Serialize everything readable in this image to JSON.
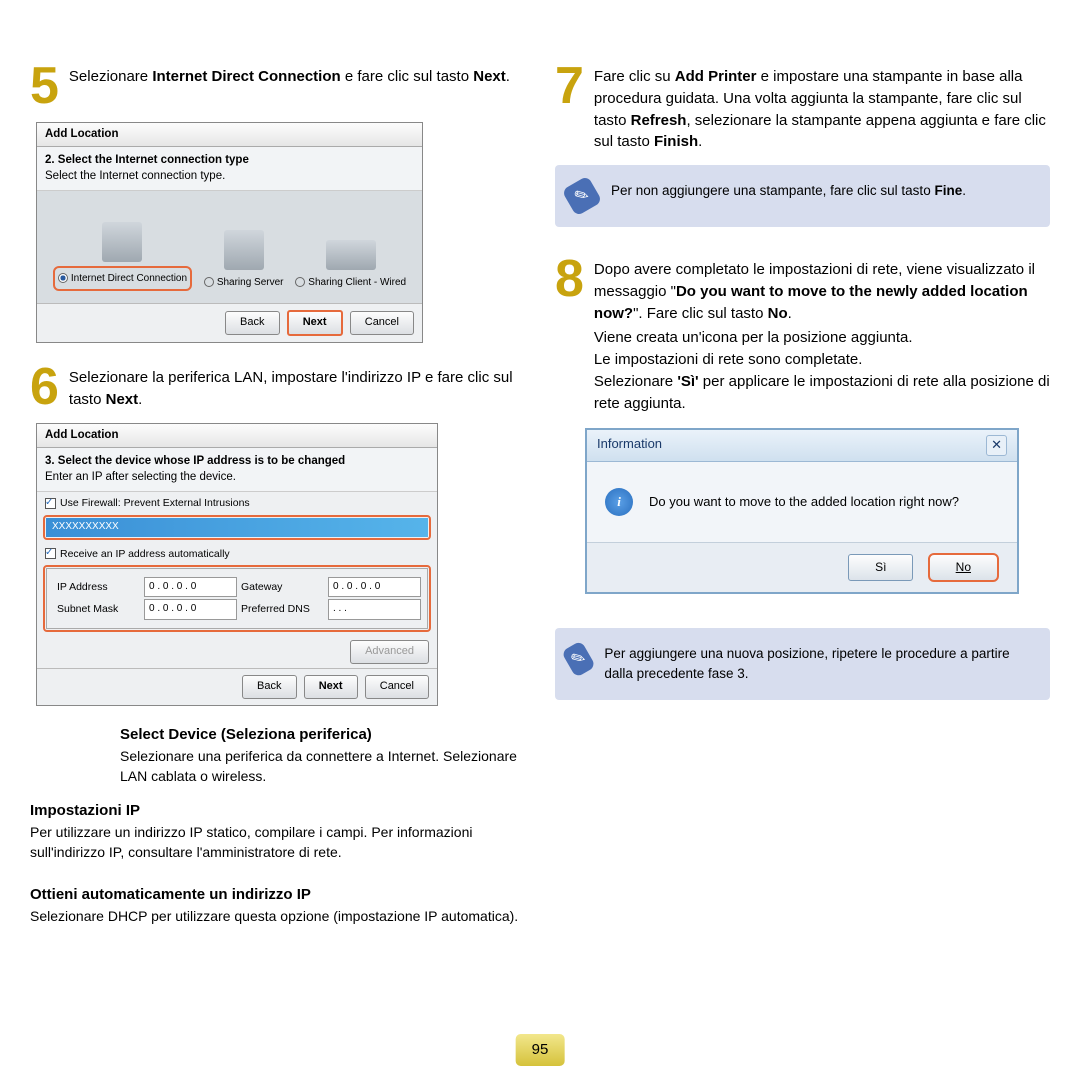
{
  "page_number": "95",
  "step5": {
    "num": "5",
    "text_pre": "Selezionare ",
    "bold1": "Internet Direct Connection",
    "text_mid": " e fare clic sul tasto ",
    "bold2": "Next",
    "text_post": "."
  },
  "dialog5": {
    "title": "Add Location",
    "subtitle_bold": "2. Select the Internet connection type",
    "subtitle_desc": "Select the Internet connection type.",
    "opt1": "Internet Direct Connection",
    "opt2": "Sharing Server",
    "opt3": "Sharing Client - Wired",
    "back": "Back",
    "next": "Next",
    "cancel": "Cancel"
  },
  "step6": {
    "num": "6",
    "line1": "Selezionare la periferica LAN, impostare l'indirizzo IP e fare clic sul tasto ",
    "bold": "Next",
    "post": "."
  },
  "dialog6": {
    "title": "Add Location",
    "subtitle_bold": "3. Select the device whose IP address is to be changed",
    "subtitle_desc": "Enter an IP after selecting the device.",
    "firewall": "Use Firewall: Prevent External Intrusions",
    "device_placeholder": "XXXXXXXXXX",
    "auto_ip": "Receive an IP address automatically",
    "ip_addr_label": "IP Address",
    "ip_val": "0 . 0 . 0 . 0",
    "subnet_label": "Subnet Mask",
    "gateway_label": "Gateway",
    "dns_label": "Preferred DNS",
    "dns_val": ". . .",
    "advanced": "Advanced",
    "back": "Back",
    "next": "Next",
    "cancel": "Cancel"
  },
  "callouts": {
    "select_device_title": "Select Device (Seleziona periferica)",
    "select_device_text": "Selezionare una periferica da connettere a Internet. Selezionare LAN cablata o wireless.",
    "ip_settings_title": "Impostazioni IP",
    "ip_settings_text": "Per utilizzare un indirizzo IP statico, compilare i campi. Per informazioni sull'indirizzo IP, consultare l'amministratore di rete.",
    "auto_ip_title": "Ottieni automaticamente un indirizzo IP",
    "auto_ip_text": "Selezionare DHCP per utilizzare questa opzione (impostazione IP automatica)."
  },
  "step7": {
    "num": "7",
    "pre": "Fare clic su ",
    "b1": "Add Printer",
    "mid1": " e impostare una stampante in base alla procedura guidata. Una volta aggiunta la stampante, fare clic sul tasto ",
    "b2": "Refresh",
    "mid2": ", selezionare la stampante appena aggiunta e fare clic sul tasto ",
    "b3": "Finish",
    "post": "."
  },
  "note7": {
    "text": "Per non aggiungere una stampante, fare clic sul tasto ",
    "bold": "Fine",
    "post": "."
  },
  "step8": {
    "num": "8",
    "l1": "Dopo avere completato le impostazioni di rete, viene visualizzato il messaggio \"",
    "b1": "Do you want to move to the newly added location now?",
    "l2": "\". Fare clic sul tasto ",
    "b2": "No",
    "l3": ".",
    "l4": "Viene creata un'icona per la posizione aggiunta.",
    "l5": "Le impostazioni di rete sono completate.",
    "l6a": "Selezionare ",
    "b3": "'Sì'",
    "l6b": " per applicare le impostazioni di rete alla posizione di rete aggiunta."
  },
  "infobox": {
    "title": "Information",
    "close": "✕",
    "message": "Do you want to move to the added location right now?",
    "yes": "Sì",
    "no": "No"
  },
  "note8": {
    "text": "Per aggiungere una nuova posizione, ripetere le procedure a partire dalla precedente fase 3."
  }
}
